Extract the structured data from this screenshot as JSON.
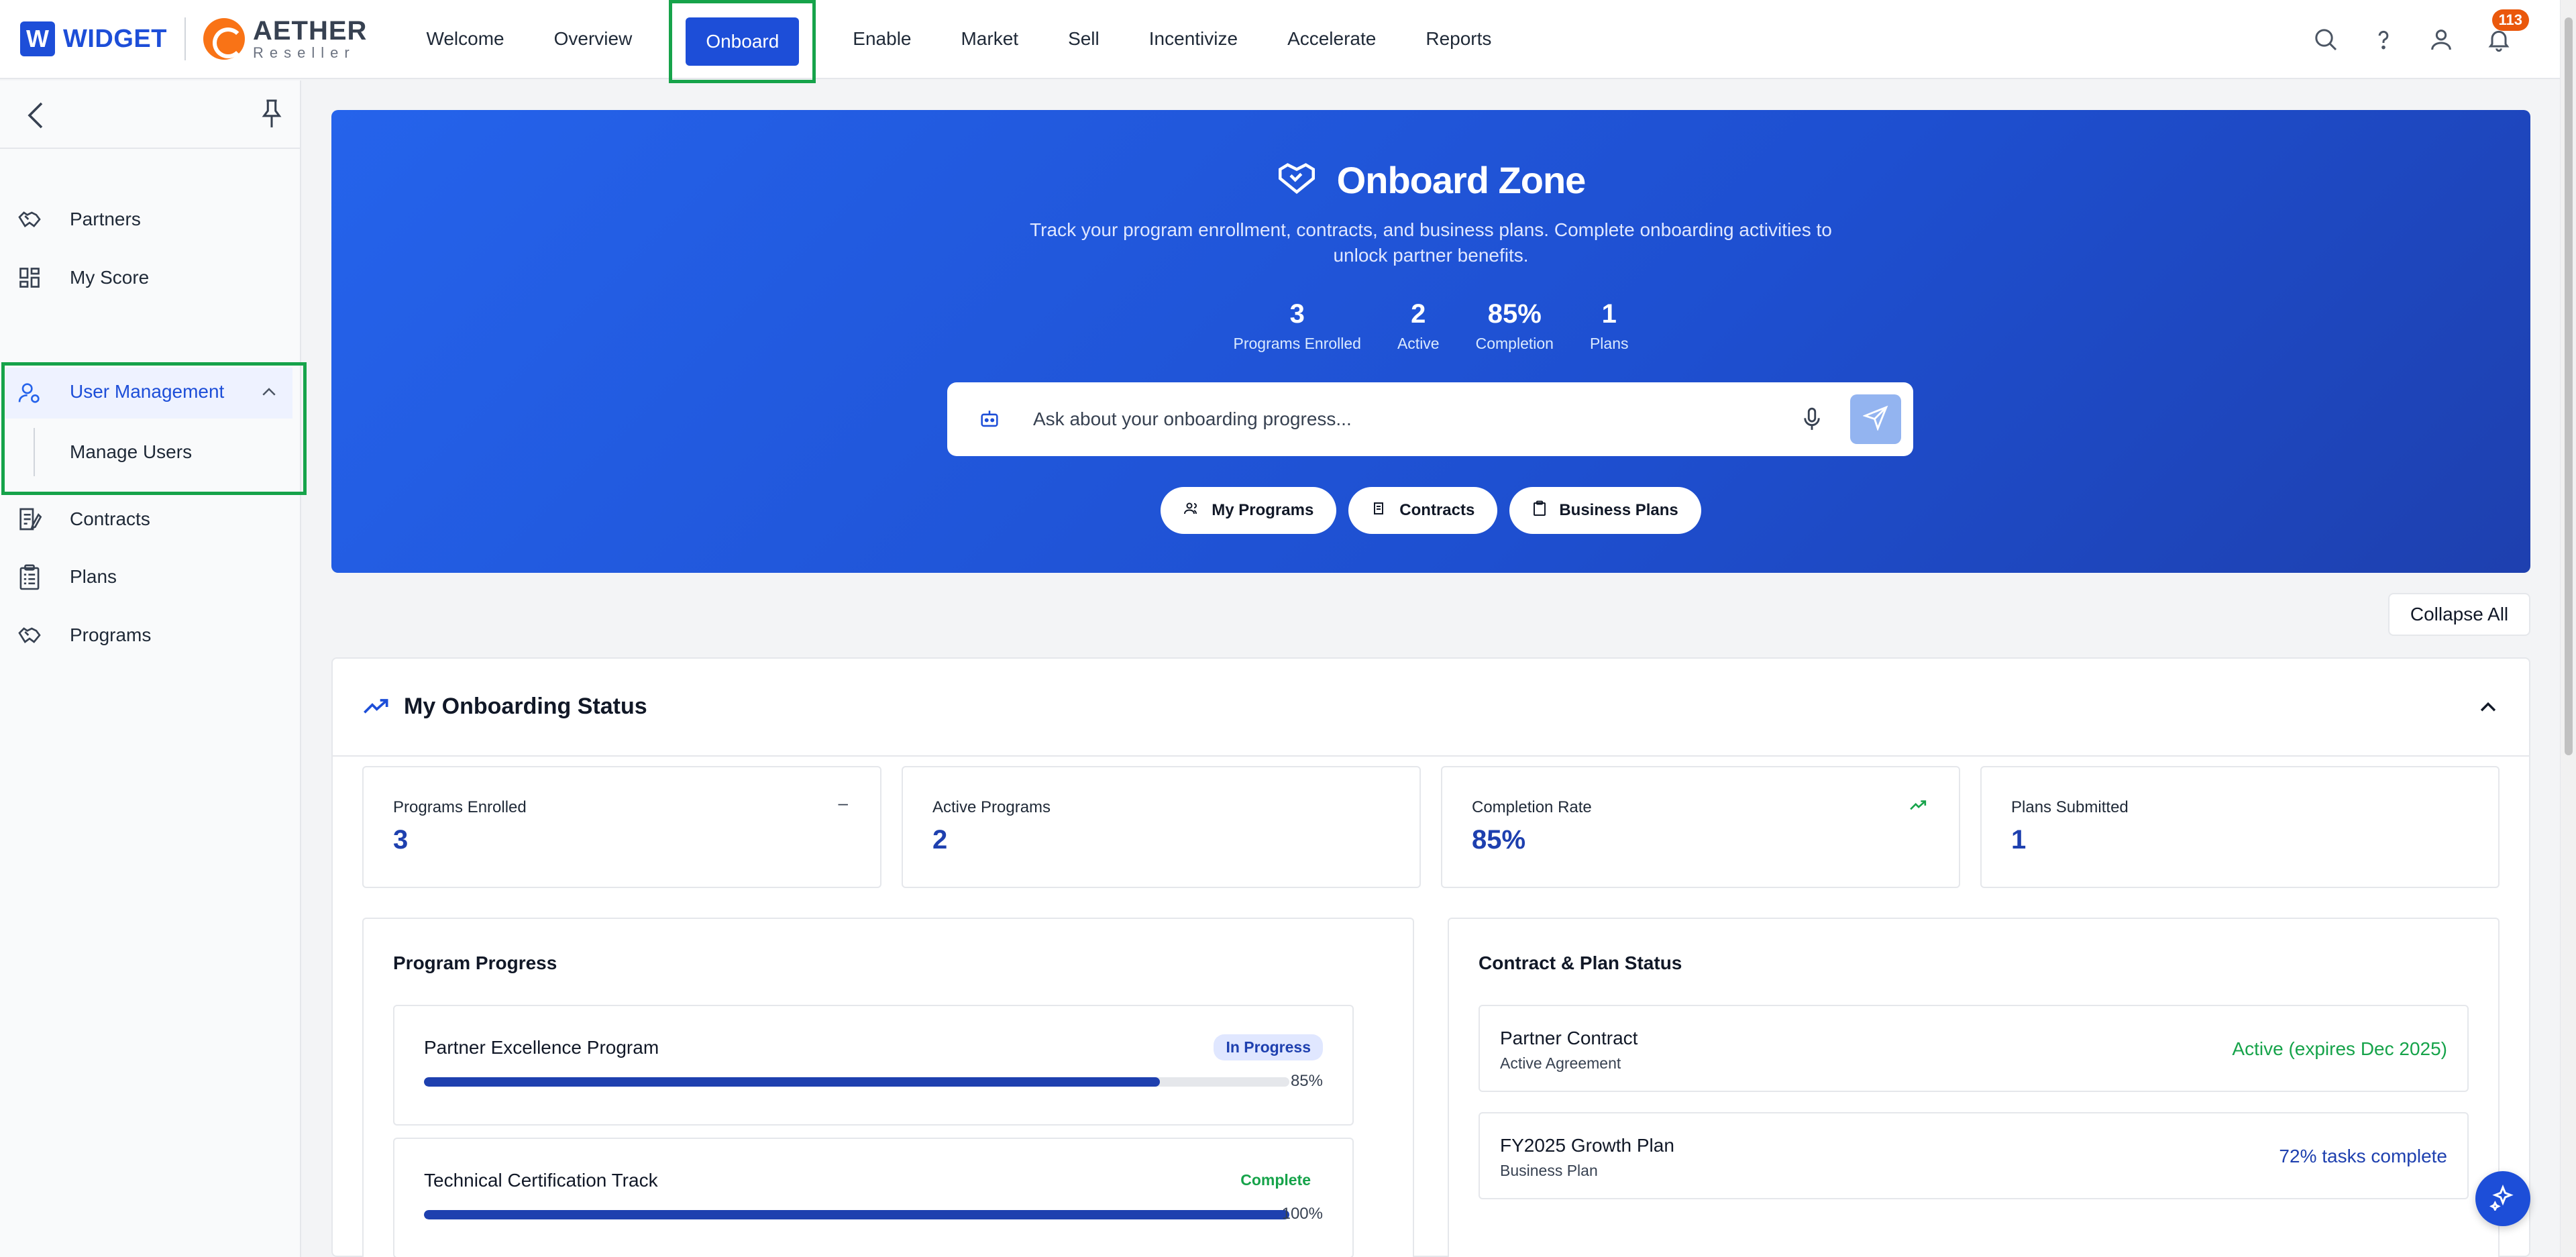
{
  "brand": {
    "widget": "WIDGET",
    "widget_letter": "W",
    "aether": "AETHER",
    "aether_sub": "Reseller"
  },
  "nav": {
    "items": [
      "Welcome",
      "Overview",
      "Onboard",
      "Enable",
      "Market",
      "Sell",
      "Incentivize",
      "Accelerate",
      "Reports"
    ],
    "active": "Onboard"
  },
  "top_icons": {
    "notifications_count": "113"
  },
  "sidebar": {
    "items": [
      {
        "label": "Partners",
        "icon": "partners-icon"
      },
      {
        "label": "My Score",
        "icon": "dashboard-icon"
      },
      {
        "label": "User Management",
        "icon": "user-settings-icon",
        "expanded": true
      },
      {
        "label": "Manage Users",
        "icon": ""
      },
      {
        "label": "Contracts",
        "icon": "contract-icon"
      },
      {
        "label": "Plans",
        "icon": "clipboard-icon"
      },
      {
        "label": "Programs",
        "icon": "programs-icon"
      }
    ]
  },
  "hero": {
    "title": "Onboard Zone",
    "description": "Track your program enrollment, contracts, and business plans. Complete onboarding activities to unlock partner benefits.",
    "stats": [
      {
        "value": "3",
        "label": "Programs Enrolled"
      },
      {
        "value": "2",
        "label": "Active"
      },
      {
        "value": "85%",
        "label": "Completion"
      },
      {
        "value": "1",
        "label": "Plans"
      }
    ],
    "ask_placeholder": "Ask about your onboarding progress...",
    "chips": [
      "My Programs",
      "Contracts",
      "Business Plans"
    ]
  },
  "collapse_all": "Collapse All",
  "status": {
    "title": "My Onboarding Status",
    "metrics": [
      {
        "label": "Programs Enrolled",
        "value": "3",
        "indicator": "–"
      },
      {
        "label": "Active Programs",
        "value": "2",
        "indicator": ""
      },
      {
        "label": "Completion Rate",
        "value": "85%",
        "indicator": "trend-up"
      },
      {
        "label": "Plans Submitted",
        "value": "1",
        "indicator": ""
      }
    ],
    "program_progress": {
      "title": "Program Progress",
      "items": [
        {
          "name": "Partner Excellence Program",
          "badge": "In Progress",
          "progress": 85,
          "pct_label": "85%"
        },
        {
          "name": "Technical Certification Track",
          "badge": "Complete",
          "progress": 100,
          "pct_label": "100%"
        }
      ]
    },
    "contract_plan": {
      "title": "Contract & Plan Status",
      "items": [
        {
          "name": "Partner Contract",
          "sub": "Active Agreement",
          "status": "Active (expires Dec 2025)",
          "color": "#16a34a"
        },
        {
          "name": "FY2025 Growth Plan",
          "sub": "Business Plan",
          "status": "72% tasks complete",
          "color": "#1e40af"
        }
      ]
    }
  },
  "colors": {
    "primary": "#1d4ed8",
    "highlight": "#16a34a",
    "accent": "#f97316",
    "badge": "#ea580c"
  }
}
